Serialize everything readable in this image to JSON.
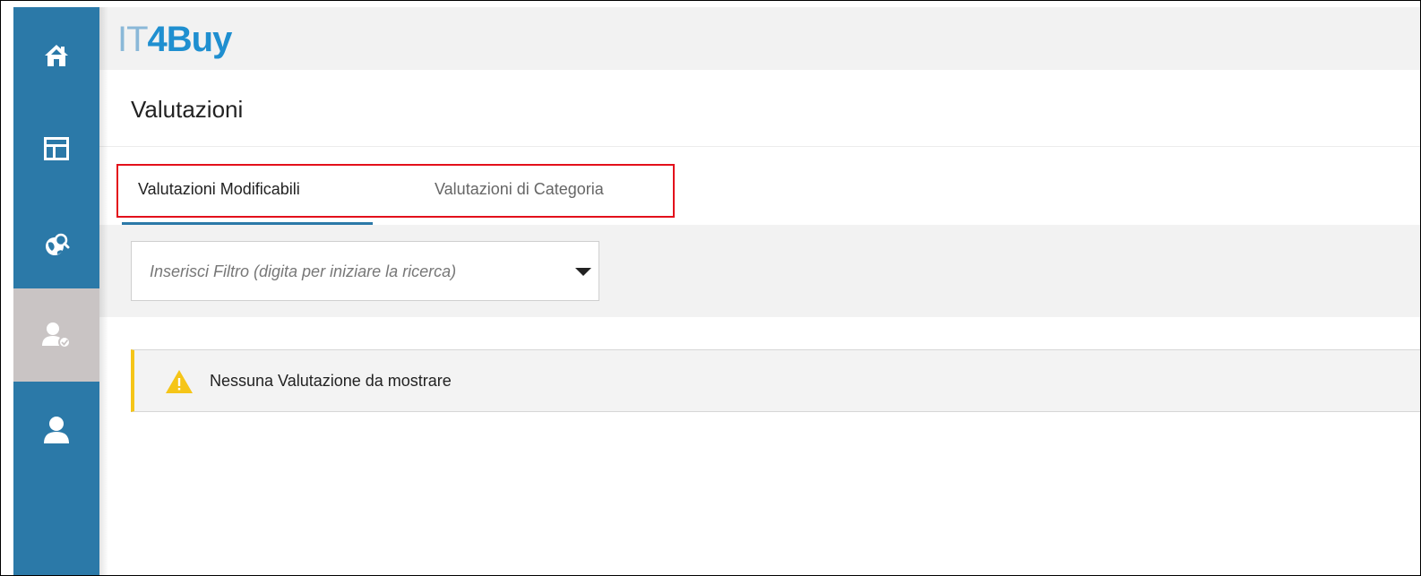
{
  "app": {
    "logo_prefix": "IT",
    "logo_suffix": "4Buy"
  },
  "sidebar": {
    "items": [
      {
        "icon": "home-icon"
      },
      {
        "icon": "dashboard-icon"
      },
      {
        "icon": "globe-search-icon"
      },
      {
        "icon": "user-check-icon",
        "active": true
      },
      {
        "icon": "user-icon"
      }
    ]
  },
  "page": {
    "title": "Valutazioni"
  },
  "tabs": [
    {
      "label": "Valutazioni Modificabili",
      "active": true
    },
    {
      "label": "Valutazioni di Categoria",
      "active": false
    }
  ],
  "filter": {
    "placeholder": "Inserisci Filtro (digita per iniziare la ricerca)",
    "value": ""
  },
  "alert": {
    "message": "Nessuna Valutazione da mostrare",
    "icon": "warning-icon"
  },
  "colors": {
    "sidebar": "#2b79a8",
    "sidebar_active": "#c9c4c4",
    "logo_light": "#8ab8d8",
    "logo_dark": "#1f8fd0",
    "highlight": "#e3101b",
    "warning": "#f5c518"
  }
}
